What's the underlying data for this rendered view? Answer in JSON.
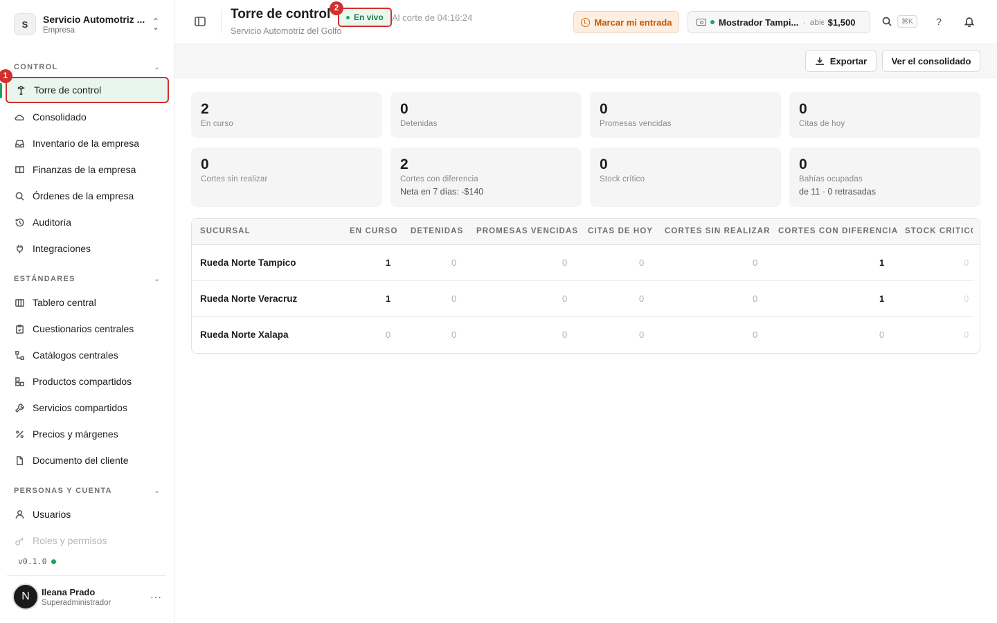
{
  "org": {
    "initial": "S",
    "name": "Servicio Automotriz ...",
    "type": "Empresa"
  },
  "sections": {
    "control": "CONTROL",
    "standards": "ESTÁNDARES",
    "people": "PERSONAS Y CUENTA"
  },
  "nav": {
    "control": [
      {
        "label": "Torre de control",
        "icon": "tower-icon",
        "active": true
      },
      {
        "label": "Consolidado",
        "icon": "cloud-icon"
      },
      {
        "label": "Inventario de la empresa",
        "icon": "inbox-icon"
      },
      {
        "label": "Finanzas de la empresa",
        "icon": "book-icon"
      },
      {
        "label": "Órdenes de la empresa",
        "icon": "search-icon"
      },
      {
        "label": "Auditoría",
        "icon": "history-icon"
      },
      {
        "label": "Integraciones",
        "icon": "plug-icon"
      }
    ],
    "standards": [
      {
        "label": "Tablero central",
        "icon": "columns-icon"
      },
      {
        "label": "Cuestionarios centrales",
        "icon": "clipboard-icon"
      },
      {
        "label": "Catálogos centrales",
        "icon": "tree-icon"
      },
      {
        "label": "Productos compartidos",
        "icon": "boxes-icon"
      },
      {
        "label": "Servicios compartidos",
        "icon": "wrench-icon"
      },
      {
        "label": "Precios y márgenes",
        "icon": "percent-icon"
      },
      {
        "label": "Documento del cliente",
        "icon": "document-icon"
      }
    ],
    "people": [
      {
        "label": "Usuarios",
        "icon": "user-icon"
      },
      {
        "label": "Roles y permisos",
        "icon": "key-icon"
      }
    ]
  },
  "annotations": {
    "one": "1",
    "two": "2"
  },
  "version": "v0.1.0",
  "user": {
    "initial": "N",
    "name": "Ileana Prado",
    "role": "Superadministrador",
    "more": "···"
  },
  "header": {
    "title": "Torre de control",
    "subtitle": "Servicio Automotriz del Golfo",
    "live": "En vivo",
    "cut": "Al corte de 04:16:24",
    "mark_entry": "Marcar mi entrada",
    "cashbox": {
      "name": "Mostrador Tampi...",
      "sep": "·",
      "state": "abierta",
      "amount": "$1,500"
    },
    "shortcut": "⌘K",
    "help": "?"
  },
  "actions": {
    "export": "Exportar",
    "consolidated": "Ver el consolidado"
  },
  "kpis": [
    {
      "value": "2",
      "label": "En curso"
    },
    {
      "value": "0",
      "label": "Detenidas"
    },
    {
      "value": "0",
      "label": "Promesas vencidas"
    },
    {
      "value": "0",
      "label": "Citas de hoy"
    },
    {
      "value": "0",
      "label": "Cortes sin realizar"
    },
    {
      "value": "2",
      "label": "Cortes con diferencia",
      "extra": "Neta en 7 días: -$140"
    },
    {
      "value": "0",
      "label": "Stock crítico"
    },
    {
      "value": "0",
      "label": "Bahías ocupadas",
      "extra": "de 11 · 0 retrasadas"
    }
  ],
  "table": {
    "columns": [
      "SUCURSAL",
      "EN CURSO",
      "DETENIDAS",
      "PROMESAS VENCIDAS",
      "CITAS DE HOY",
      "CORTES SIN REALIZAR",
      "CORTES CON DIFERENCIA",
      "STOCK CRÍTICO"
    ],
    "rows": [
      {
        "branch": "Rueda Norte Tampico",
        "cells": [
          "1",
          "0",
          "0",
          "0",
          "0",
          "1",
          "0"
        ]
      },
      {
        "branch": "Rueda Norte Veracruz",
        "cells": [
          "1",
          "0",
          "0",
          "0",
          "0",
          "1",
          "0"
        ]
      },
      {
        "branch": "Rueda Norte Xalapa",
        "cells": [
          "0",
          "0",
          "0",
          "0",
          "0",
          "0",
          "0"
        ]
      }
    ]
  },
  "colors": {
    "accent_green": "#22a35a",
    "active_bg": "#e8f6ee",
    "annotation_red": "#d22f2f",
    "warning_orange": "#c2580a"
  }
}
